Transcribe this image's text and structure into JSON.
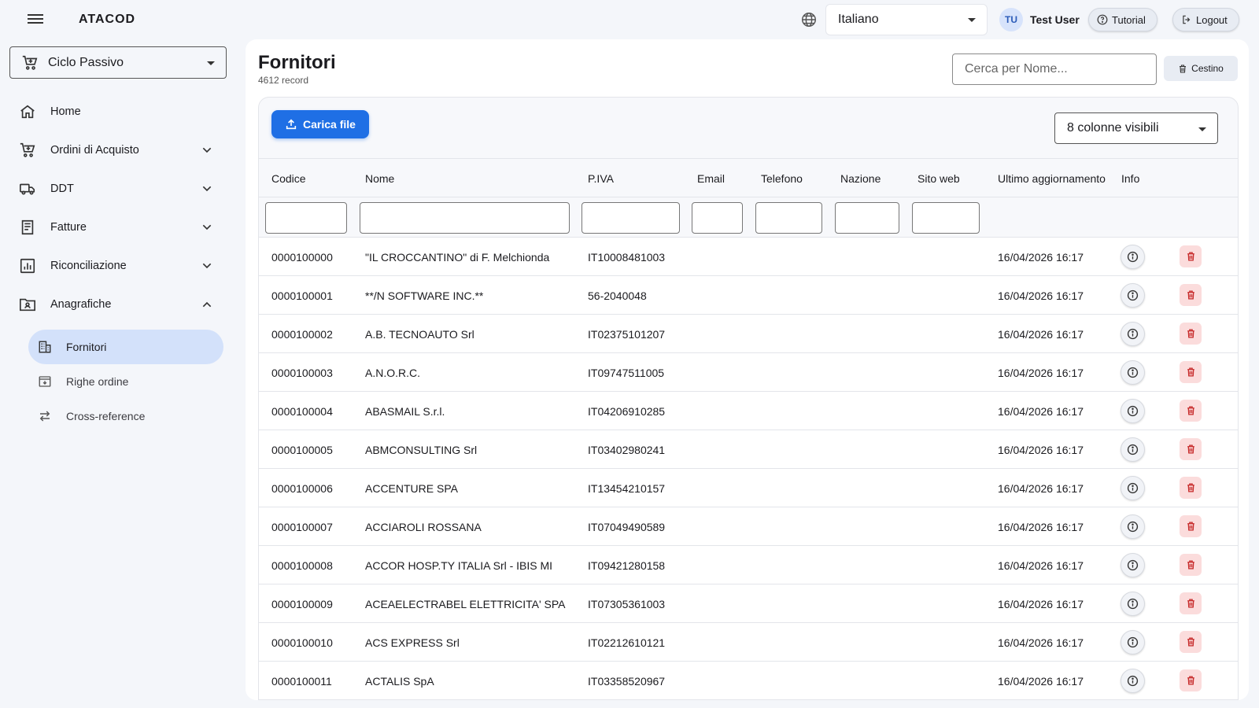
{
  "app": {
    "brand": "ATACOD"
  },
  "header": {
    "language": "Italiano",
    "user_initials": "TU",
    "user_name": "Test User",
    "tutorial_label": "Tutorial",
    "logout_label": "Logout"
  },
  "sidebar": {
    "module": "Ciclo Passivo",
    "items": [
      {
        "label": "Home",
        "icon": "home-icon"
      },
      {
        "label": "Ordini di Acquisto",
        "icon": "cart-icon",
        "expanded": false
      },
      {
        "label": "DDT",
        "icon": "truck-icon",
        "expanded": false
      },
      {
        "label": "Fatture",
        "icon": "receipt-icon",
        "expanded": false
      },
      {
        "label": "Riconciliazione",
        "icon": "chart-icon",
        "expanded": false
      },
      {
        "label": "Anagrafiche",
        "icon": "folder-user-icon",
        "expanded": true
      }
    ],
    "subitems": [
      {
        "label": "Fornitori",
        "icon": "building-icon",
        "active": true
      },
      {
        "label": "Righe ordine",
        "icon": "order-lines-icon",
        "active": false
      },
      {
        "label": "Cross-reference",
        "icon": "swap-icon",
        "active": false
      }
    ]
  },
  "page": {
    "title": "Fornitori",
    "record_count": "4612 record",
    "search_placeholder": "Cerca per Nome...",
    "trash_label": "Cestino",
    "upload_label": "Carica file",
    "columns_visible": "8 colonne visibili"
  },
  "table": {
    "columns": [
      "Codice",
      "Nome",
      "P.IVA",
      "Email",
      "Telefono",
      "Nazione",
      "Sito web",
      "Ultimo aggiornamento",
      "Info"
    ],
    "rows": [
      {
        "codice": "0000100000",
        "nome": "\"IL CROCCANTINO\" di F. Melchionda",
        "piva": "IT10008481003",
        "email": "",
        "telefono": "",
        "nazione": "",
        "sito": "",
        "aggiornamento": "16/04/2026 16:17"
      },
      {
        "codice": "0000100001",
        "nome": "**/N SOFTWARE INC.**",
        "piva": "56-2040048",
        "email": "",
        "telefono": "",
        "nazione": "",
        "sito": "",
        "aggiornamento": "16/04/2026 16:17"
      },
      {
        "codice": "0000100002",
        "nome": "A.B. TECNOAUTO Srl",
        "piva": "IT02375101207",
        "email": "",
        "telefono": "",
        "nazione": "",
        "sito": "",
        "aggiornamento": "16/04/2026 16:17"
      },
      {
        "codice": "0000100003",
        "nome": "A.N.O.R.C.",
        "piva": "IT09747511005",
        "email": "",
        "telefono": "",
        "nazione": "",
        "sito": "",
        "aggiornamento": "16/04/2026 16:17"
      },
      {
        "codice": "0000100004",
        "nome": "ABASMAIL S.r.l.",
        "piva": "IT04206910285",
        "email": "",
        "telefono": "",
        "nazione": "",
        "sito": "",
        "aggiornamento": "16/04/2026 16:17"
      },
      {
        "codice": "0000100005",
        "nome": "ABMCONSULTING Srl",
        "piva": "IT03402980241",
        "email": "",
        "telefono": "",
        "nazione": "",
        "sito": "",
        "aggiornamento": "16/04/2026 16:17"
      },
      {
        "codice": "0000100006",
        "nome": "ACCENTURE SPA",
        "piva": "IT13454210157",
        "email": "",
        "telefono": "",
        "nazione": "",
        "sito": "",
        "aggiornamento": "16/04/2026 16:17"
      },
      {
        "codice": "0000100007",
        "nome": "ACCIAROLI ROSSANA",
        "piva": "IT07049490589",
        "email": "",
        "telefono": "",
        "nazione": "",
        "sito": "",
        "aggiornamento": "16/04/2026 16:17"
      },
      {
        "codice": "0000100008",
        "nome": "ACCOR HOSP.TY ITALIA Srl - IBIS MI",
        "piva": "IT09421280158",
        "email": "",
        "telefono": "",
        "nazione": "",
        "sito": "",
        "aggiornamento": "16/04/2026 16:17"
      },
      {
        "codice": "0000100009",
        "nome": "ACEAELECTRABEL ELETTRICITA' SPA",
        "piva": "IT07305361003",
        "email": "",
        "telefono": "",
        "nazione": "",
        "sito": "",
        "aggiornamento": "16/04/2026 16:17"
      },
      {
        "codice": "0000100010",
        "nome": "ACS EXPRESS Srl",
        "piva": "IT02212610121",
        "email": "",
        "telefono": "",
        "nazione": "",
        "sito": "",
        "aggiornamento": "16/04/2026 16:17"
      },
      {
        "codice": "0000100011",
        "nome": "ACTALIS SpA",
        "piva": "IT03358520967",
        "email": "",
        "telefono": "",
        "nazione": "",
        "sito": "",
        "aggiornamento": "16/04/2026 16:17"
      }
    ]
  },
  "colors": {
    "accent": "#1f6fe5",
    "active_nav": "#d3e1fa",
    "danger": "#c62828",
    "danger_bg": "#fbdcdc"
  }
}
